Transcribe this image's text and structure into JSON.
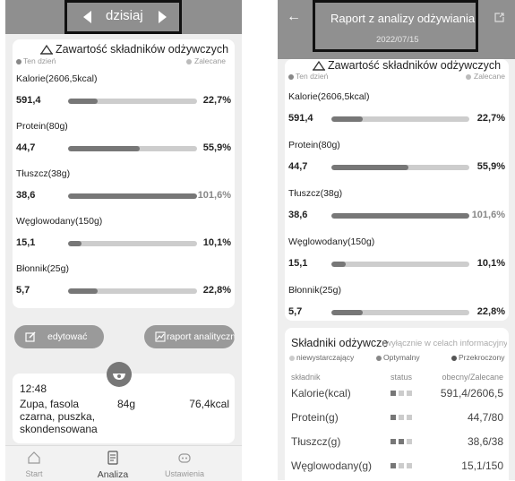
{
  "left": {
    "header": {
      "date_label": "dzisiaj"
    },
    "card_title": "Zawartość składników odżywczych",
    "legend": {
      "today": "Ten dzień",
      "recommended": "Zalecane"
    },
    "nutrients": [
      {
        "label": "Kalorie(2606,5kcal)",
        "value": "591,4",
        "percent": "22,7%",
        "fill": 0.227
      },
      {
        "label": "Protein(80g)",
        "value": "44,7",
        "percent": "55,9%",
        "fill": 0.559
      },
      {
        "label": "Tłuszcz(38g)",
        "value": "38,6",
        "percent": "101,6%",
        "fill": 1.0
      },
      {
        "label": "Węglowodany(150g)",
        "value": "15,1",
        "percent": "10,1%",
        "fill": 0.101
      },
      {
        "label": "Błonnik(25g)",
        "value": "5,7",
        "percent": "22,8%",
        "fill": 0.228
      }
    ],
    "edit_button": "edytować",
    "report_button": "raport analityczny",
    "meal": {
      "time": "12:48",
      "name": "Zupa, fasola czarna, puszka, skondensowana",
      "weight": "84g",
      "kcal": "76,4kcal"
    },
    "nav": [
      {
        "label": "Start",
        "icon": "home-icon"
      },
      {
        "label": "Analiza",
        "icon": "analysis-icon"
      },
      {
        "label": "Ustawienia",
        "icon": "settings-icon"
      }
    ]
  },
  "right": {
    "header": {
      "title": "Raport z analizy odżywiania",
      "date": "2022/07/15"
    },
    "card_title": "Zawartość składników odżywczych",
    "legend": {
      "today": "Ten dzień",
      "recommended": "Zalecane"
    },
    "nutrients": [
      {
        "label": "Kalorie(2606,5kcal)",
        "value": "591,4",
        "percent": "22,7%",
        "fill": 0.227
      },
      {
        "label": "Protein(80g)",
        "value": "44,7",
        "percent": "55,9%",
        "fill": 0.559
      },
      {
        "label": "Tłuszcz(38g)",
        "value": "38,6",
        "percent": "101,6%",
        "fill": 1.0
      },
      {
        "label": "Węglowodany(150g)",
        "value": "15,1",
        "percent": "10,1%",
        "fill": 0.101
      },
      {
        "label": "Błonnik(25g)",
        "value": "5,7",
        "percent": "22,8%",
        "fill": 0.228
      }
    ],
    "table": {
      "title": "Składniki odżywcze",
      "subtitle": "(wyłącznie w celach informacyjnych)",
      "legend": [
        "niewystarczający",
        "Optymalny",
        "Przekroczony"
      ],
      "headers": [
        "składnik",
        "status",
        "obecny/Zalecane"
      ],
      "rows": [
        {
          "name": "Kalorie(kcal)",
          "value": "591,4/2606,5",
          "status": 1
        },
        {
          "name": "Protein(g)",
          "value": "44,7/80",
          "status": 1
        },
        {
          "name": "Tłuszcz(g)",
          "value": "38,6/38",
          "status": 2
        },
        {
          "name": "Węglowodany(g)",
          "value": "15,1/150",
          "status": 1
        }
      ]
    }
  }
}
